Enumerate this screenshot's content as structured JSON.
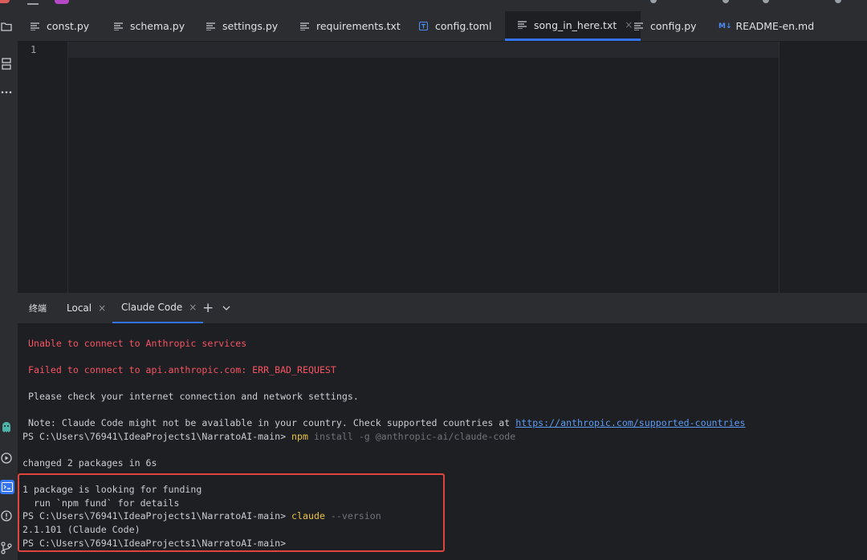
{
  "editor_tabs": [
    {
      "label": "const.py",
      "icon": "text-file-icon"
    },
    {
      "label": "schema.py",
      "icon": "text-file-icon"
    },
    {
      "label": "settings.py",
      "icon": "text-file-icon"
    },
    {
      "label": "requirements.txt",
      "icon": "text-file-icon"
    },
    {
      "label": "config.toml",
      "icon": "toml-file-icon"
    },
    {
      "label": "song_in_here.txt",
      "icon": "text-file-icon",
      "active": true
    },
    {
      "label": "config.py",
      "icon": "text-file-icon"
    },
    {
      "label": "README-en.md",
      "icon": "markdown-file-icon",
      "icon_text": "M↓"
    }
  ],
  "tab_close_glyph": "×",
  "editor": {
    "line_number": "1"
  },
  "terminal_header": {
    "title": "终端",
    "tabs": [
      {
        "label": "Local"
      },
      {
        "label": "Claude Code",
        "active": true
      }
    ],
    "close_glyph": "×",
    "add_glyph": "+",
    "dropdown_glyph": "⌄"
  },
  "terminal": {
    "msg_unable": " Unable to connect to Anthropic services",
    "msg_failed": " Failed to connect to api.anthropic.com: ERR_BAD_REQUEST",
    "msg_check": " Please check your internet connection and network settings.",
    "msg_note": " Note: Claude Code might not be available in your country. Check supported countries at ",
    "msg_note_link": "https://anthropic.com/supported-countries",
    "prompt": "PS C:\\Users\\76941\\IdeaProjects1\\NarratoAI-main> ",
    "cmd1": "npm",
    "cmd1_args": " install -g @anthropic-ai/claude-code",
    "changed": "changed 2 packages in 6s",
    "funding": "1 package is looking for funding",
    "fund_hint": "  run `npm fund` for details",
    "cmd2": "claude",
    "cmd2_args": " --version",
    "version_out": "2.1.101 (Claude Code)",
    "final_prompt": "PS C:\\Users\\76941\\IdeaProjects1\\NarratoAI-main>"
  },
  "colors": {
    "accent": "#3574f0",
    "error_red": "#f75464",
    "command_yellow": "#e8c340",
    "highlight_box": "#e0443e"
  }
}
